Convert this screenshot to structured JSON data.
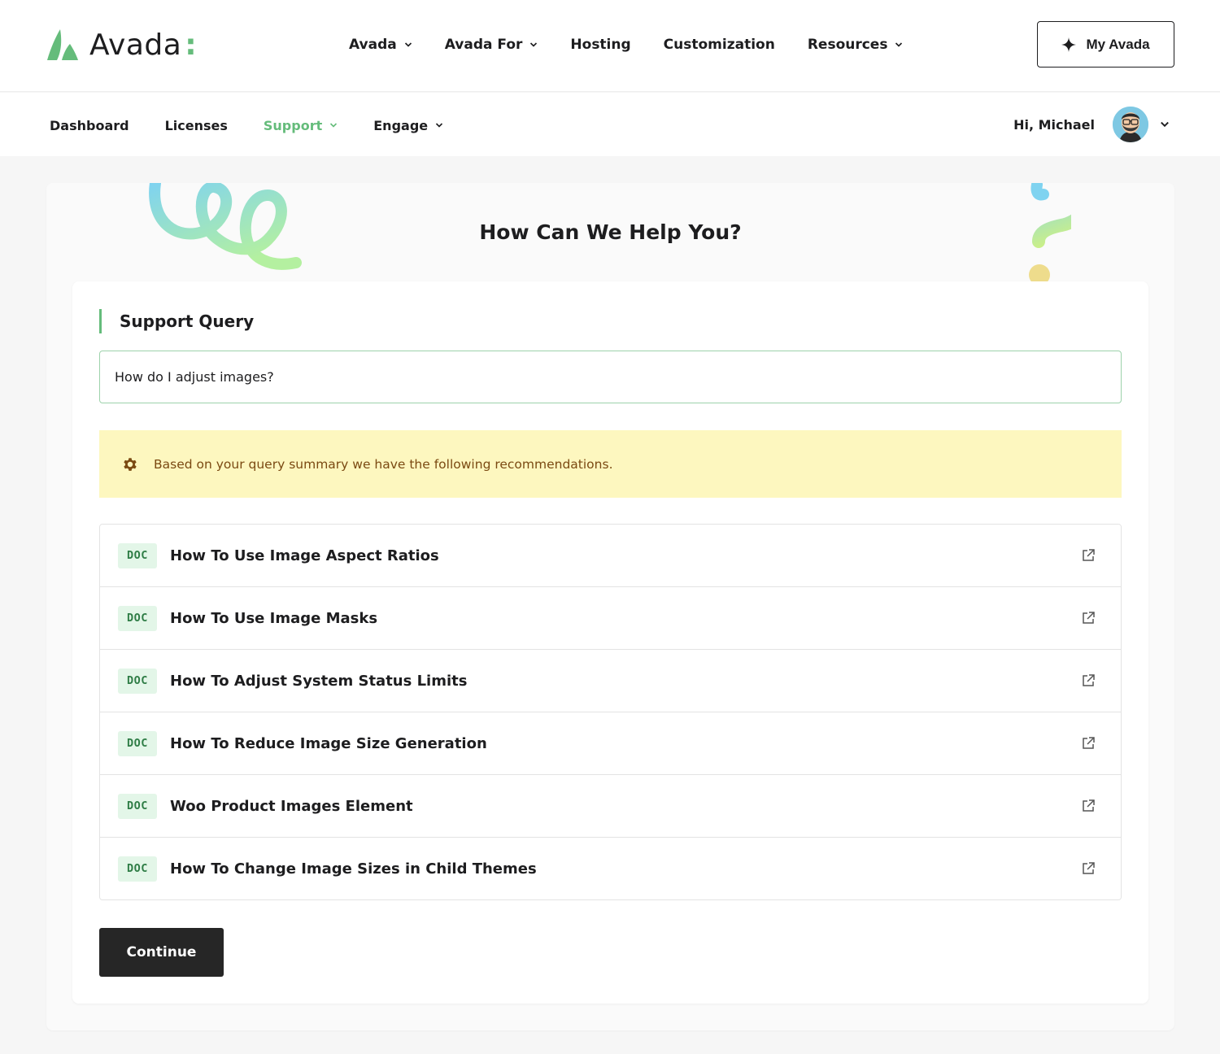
{
  "header": {
    "logo_text": "Avada",
    "logo_colon": ":",
    "nav": [
      {
        "label": "Avada",
        "dropdown": true
      },
      {
        "label": "Avada For",
        "dropdown": true
      },
      {
        "label": "Hosting",
        "dropdown": false
      },
      {
        "label": "Customization",
        "dropdown": false
      },
      {
        "label": "Resources",
        "dropdown": true
      }
    ],
    "cta_label": "My Avada"
  },
  "subnav": {
    "items": [
      {
        "label": "Dashboard",
        "active": false,
        "dropdown": false
      },
      {
        "label": "Licenses",
        "active": false,
        "dropdown": false
      },
      {
        "label": "Support",
        "active": true,
        "dropdown": true
      },
      {
        "label": "Engage",
        "active": false,
        "dropdown": true
      }
    ],
    "greeting": "Hi, Michael"
  },
  "hero": {
    "title": "How Can We Help You?"
  },
  "form": {
    "section_title": "Support Query",
    "query_value": "How do I adjust images?",
    "notice": "Based on your query summary we have the following recommendations.",
    "results": [
      {
        "badge": "DOC",
        "title": "How To Use Image Aspect Ratios"
      },
      {
        "badge": "DOC",
        "title": "How To Use Image Masks"
      },
      {
        "badge": "DOC",
        "title": "How To Adjust System Status Limits"
      },
      {
        "badge": "DOC",
        "title": "How To Reduce Image Size Generation"
      },
      {
        "badge": "DOC",
        "title": "Woo Product Images Element"
      },
      {
        "badge": "DOC",
        "title": "How To Change Image Sizes in Child Themes"
      }
    ],
    "continue_label": "Continue"
  },
  "colors": {
    "brand_green": "#65bc7b",
    "notice_bg": "#fdf7bf",
    "notice_text": "#7b4a12",
    "badge_bg": "#e3f6e8",
    "badge_text": "#2f7d46",
    "button_dark": "#262626"
  },
  "icons": {
    "logo": "avada-leaf-icon",
    "chevron": "chevron-down-icon",
    "cta": "sparkle-icon",
    "notice": "gear-icon",
    "external": "external-link-icon",
    "avatar": "avatar"
  }
}
